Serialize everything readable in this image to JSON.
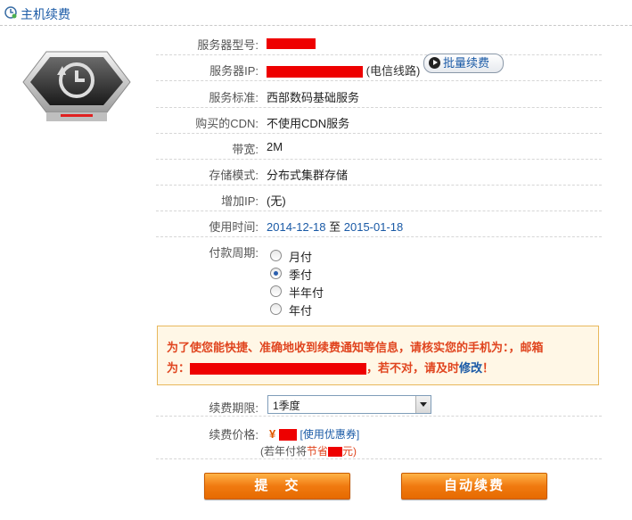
{
  "header": {
    "title": "主机续费"
  },
  "fields": {
    "model_label": "服务器型号:",
    "ip_label": "服务器IP:",
    "ip_line": "(电信线路)",
    "batch_renew": "批量续费",
    "standard_label": "服务标准:",
    "standard_value": "西部数码基础服务",
    "cdn_label": "购买的CDN:",
    "cdn_value": "不使用CDN服务",
    "bandwidth_label": "带宽:",
    "bandwidth_value": "2M",
    "storage_label": "存储模式:",
    "storage_value": "分布式集群存储",
    "extra_ip_label": "增加IP:",
    "extra_ip_value": "(无)",
    "period_label": "使用时间:",
    "period_start": "2014-12-18",
    "period_to": "至",
    "period_end": "2015-01-18"
  },
  "payment": {
    "label": "付款周期:",
    "options": [
      "月付",
      "季付",
      "半年付",
      "年付"
    ],
    "selected": "季付"
  },
  "notice": {
    "line1": "为了使您能快捷、准确地收到续费通知等信息，请核实您的手机为：，邮箱",
    "line2_prefix": "为：",
    "line2_suffix": "，若不对，请及时",
    "link": "修改",
    "line2_end": "！"
  },
  "renew": {
    "term_label": "续费期限:",
    "term_value": "1季度",
    "price_label": "续费价格:",
    "currency": "¥",
    "coupon": "[使用优惠券]",
    "save_prefix": "(若年付将",
    "save_word": "节省",
    "save_suffix": "元)"
  },
  "buttons": {
    "submit": "提　交",
    "auto_renew": "自动续费"
  },
  "colors": {
    "redact": "#ee0000",
    "link": "#1a5aa6",
    "warning": "#e0451f",
    "button": "#f07a10"
  }
}
